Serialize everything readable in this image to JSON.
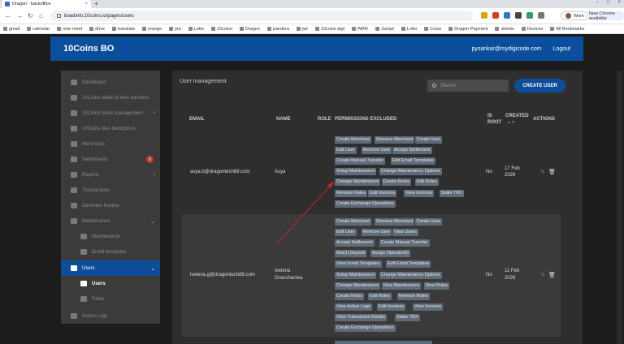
{
  "browser": {
    "tab_title": "Dragon - backoffice",
    "url": "boadmin.10coins.io/pages/users",
    "profile_label": "Work",
    "update_label": "New Chrome available",
    "bookmarks": [
      "gmail",
      "calendar",
      "new meet",
      "drive",
      "translate",
      "orange",
      "jira",
      "Lotto",
      "10coins",
      "Dragon",
      "pandora",
      "jwt",
      "10coins digi",
      "WRR",
      "Jackpt",
      "Lotto",
      "Coow",
      "Dragon Payment",
      "sheets",
      "Devices",
      "All Bookmarks"
    ]
  },
  "header": {
    "brand": "10Coins BO",
    "user_email": "pysankar@mydigicode.com",
    "logout": "Logout"
  },
  "sidebar": {
    "dashboard": "Dashboard",
    "wallet": "10Coins wallet & fees transfers",
    "funds": "10Coins funds management",
    "fees": "10Coins fees deductions",
    "merchants": "Merchants",
    "settlements": "Settlements",
    "settlements_badge": "0",
    "reports": "Reports",
    "transactions": "Transactions",
    "generate_invoice": "Generate Invoice",
    "maintenance": "Maintenance",
    "maintenance_sub": "Maintenance",
    "email_templates": "Email templates",
    "users": "Users",
    "users_sub": "Users",
    "roles": "Roles",
    "action_logs": "Action Logs"
  },
  "main": {
    "title": "User management",
    "search_placeholder": "Search",
    "create_user": "CREATE USER",
    "columns": {
      "email": "EMAIL",
      "name": "NAME",
      "role": "ROLE",
      "permissions": "PERMISSIONS EXCLUDED",
      "is_root_1": "IS",
      "is_root_2": "ROOT",
      "created": "CREATED",
      "sort": "▲▼",
      "actions": "ACTIONS"
    },
    "rows": [
      {
        "email": "asya.b@dragontech88.com",
        "name": "Asya",
        "root": "No",
        "created_1": "17 Feb",
        "created_2": "2026",
        "chips": [
          [
            "Create Merchant",
            "Remove Merchant",
            "Create User"
          ],
          [
            "Edit User",
            "Remove User",
            "Accept Settlement"
          ],
          [
            "Create Manual Transfer",
            "Edit Email Templates"
          ],
          [
            "Setup Maintenance",
            "Change Maintenance Options"
          ],
          [
            "Change Maintenance",
            "Create Roles",
            "Edit Roles"
          ],
          [
            "Remove Roles",
            "Edit Invoices",
            "View Invoices",
            "Stake TRX"
          ],
          [
            "Create Exchange Operations"
          ]
        ]
      },
      {
        "email": "ivelena.g@dragontech88.com",
        "name_1": "Ivelena",
        "name_2": "Grancharska",
        "root": "No",
        "created_1": "11 Feb",
        "created_2": "2026",
        "chips": [
          [
            "Create Merchant",
            "Remove Merchant",
            "Create User"
          ],
          [
            "Edit User",
            "Remove User",
            "View Users"
          ],
          [
            "Accept Settlement",
            "Create Manual Transfer"
          ],
          [
            "Match Deposit",
            "Assign OperatorID"
          ],
          [
            "View Email Templates",
            "Edit Email Templates"
          ],
          [
            "Setup Maintenance",
            "Change Maintenance Options"
          ],
          [
            "Change Maintenance",
            "View Maintenance",
            "View Roles"
          ],
          [
            "Create Roles",
            "Edit Roles",
            "Remove Roles"
          ],
          [
            "View Action Logs",
            "Edit Invoices",
            "View Invoices"
          ],
          [
            "View Transaction Details",
            "Stake TRX"
          ],
          [
            "Create Exchange Operations"
          ]
        ]
      }
    ]
  },
  "colors": {
    "brand_blue": "#0b4f9c",
    "chip": "#5f6b78",
    "annotation_arrow": "#d42020",
    "badge": "#c0392b"
  }
}
